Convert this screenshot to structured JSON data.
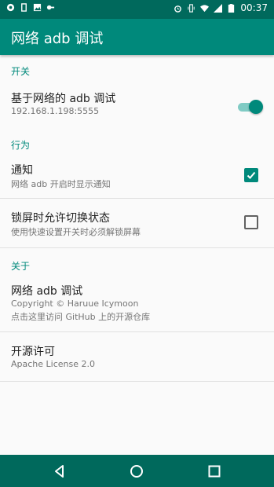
{
  "status_bar": {
    "time": "00:37",
    "icons_left": [
      "app-icon",
      "notification-icon",
      "image-icon",
      "vpn-key-icon"
    ],
    "icons_right": [
      "alarm-icon",
      "vibrate-icon",
      "wifi-icon",
      "signal-icon",
      "battery-icon"
    ]
  },
  "app_bar": {
    "title": "网络 adb 调试"
  },
  "categories": {
    "switch": "开关",
    "behavior": "行为",
    "about": "关于"
  },
  "prefs": {
    "adb_network": {
      "title": "基于网络的 adb 调试",
      "summary": "192.168.1.198:5555",
      "checked": true
    },
    "notify": {
      "title": "通知",
      "summary": "网络 adb 开启时显示通知",
      "checked": true
    },
    "lockscreen": {
      "title": "锁屏时允许切换状态",
      "summary": "使用快速设置开关时必须解锁屏幕",
      "checked": false
    },
    "app_info": {
      "title": "网络 adb 调试",
      "summary_line1": "Copyright © Haruue Icymoon",
      "summary_line2": "点击这里访问 GitHub 上的开源仓库"
    },
    "license": {
      "title": "开源许可",
      "summary": "Apache License 2.0"
    }
  },
  "colors": {
    "accent": "#00897b",
    "app_bar": "#00897b",
    "status_bar": "#00695c",
    "nav_bar": "#00695c"
  }
}
